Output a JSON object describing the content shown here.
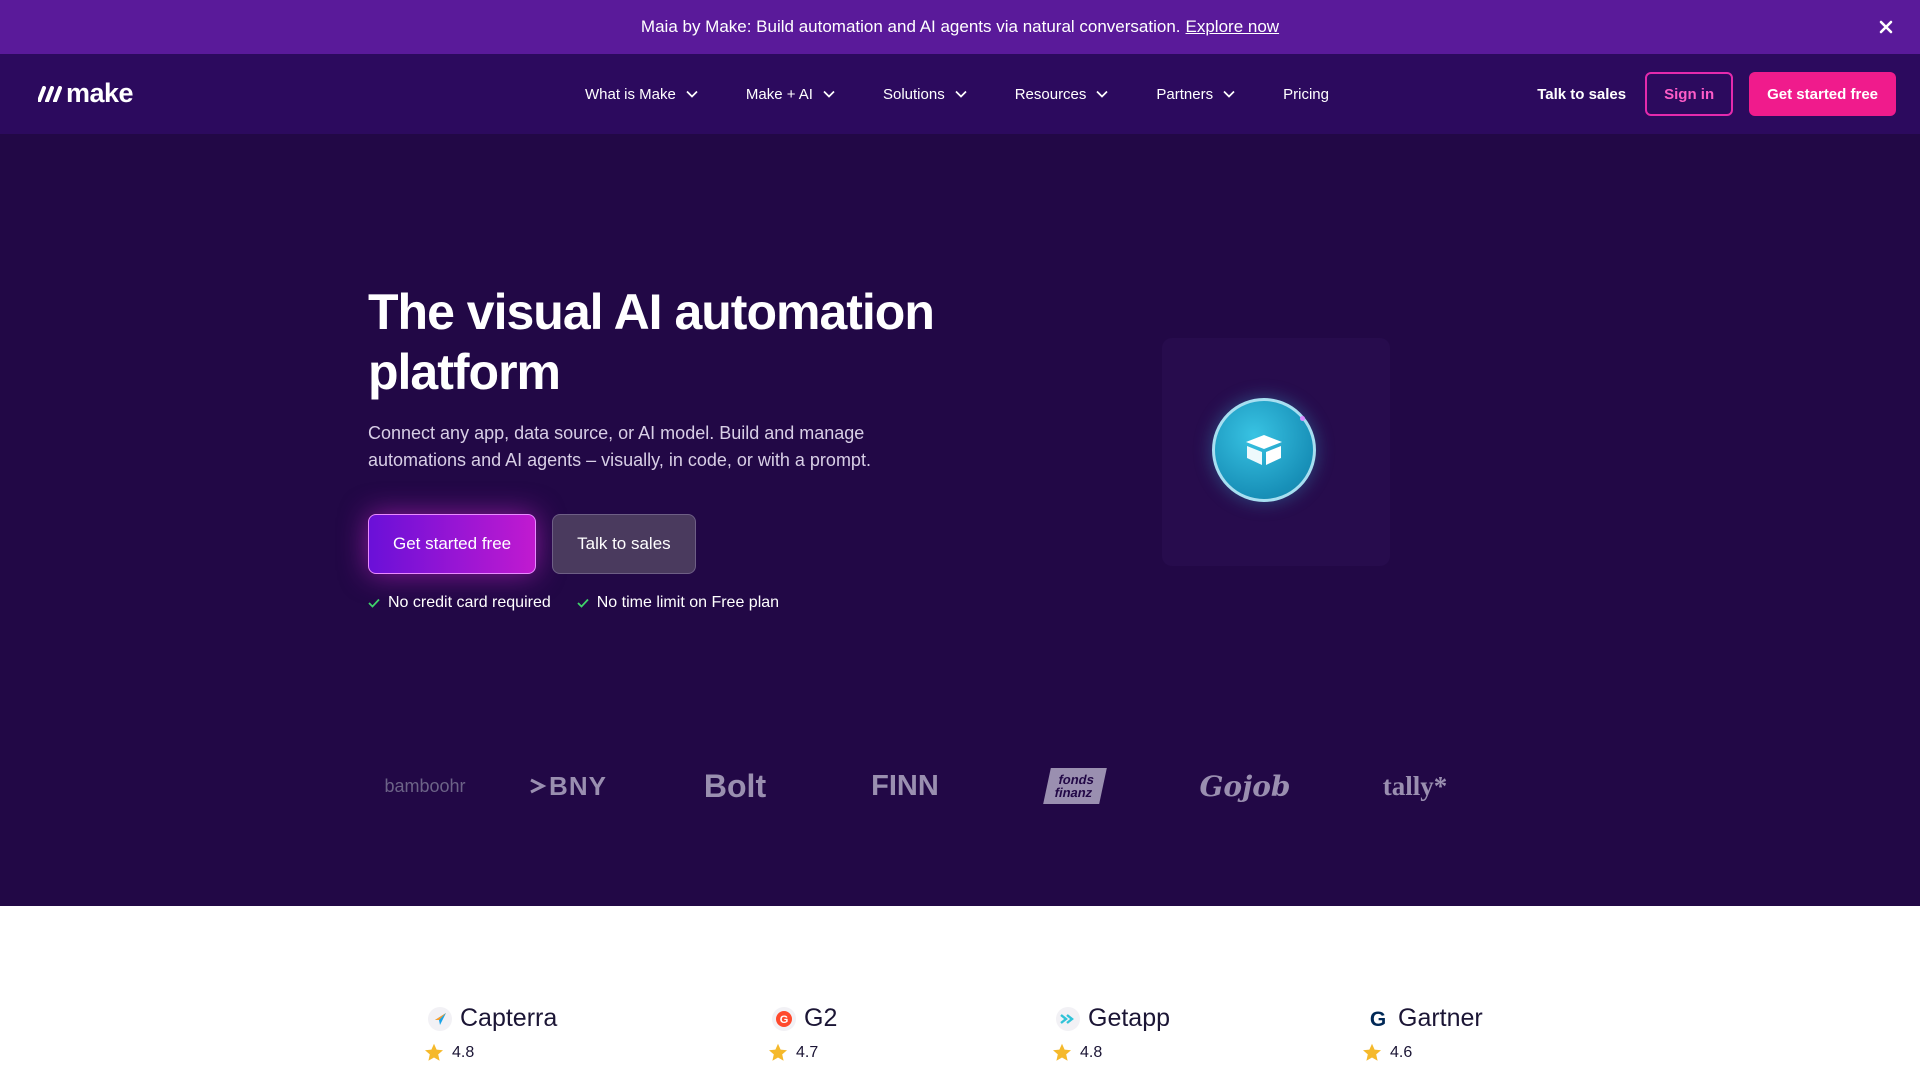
{
  "banner": {
    "text": "Maia by Make: Build automation and AI agents via natural conversation.",
    "link_label": "Explore now"
  },
  "nav": {
    "logo_text": "make",
    "items": [
      {
        "label": "What is Make",
        "has_dropdown": true
      },
      {
        "label": "Make + AI",
        "has_dropdown": true
      },
      {
        "label": "Solutions",
        "has_dropdown": true
      },
      {
        "label": "Resources",
        "has_dropdown": true
      },
      {
        "label": "Partners",
        "has_dropdown": true
      },
      {
        "label": "Pricing",
        "has_dropdown": false
      }
    ],
    "talk_to_sales": "Talk to sales",
    "sign_in": "Sign in",
    "get_started": "Get started free"
  },
  "hero": {
    "title": "The visual AI automation platform",
    "subtitle": "Connect any app, data source, or AI model. Build and manage automations and AI agents – visually, in code, or with a prompt.",
    "cta_primary": "Get started free",
    "cta_secondary": "Talk to sales",
    "checks": [
      "No credit card required",
      "No time limit on Free plan"
    ]
  },
  "logos": [
    "bamboohr",
    "BNY",
    "Bolt",
    "FINN",
    "fonds finanz",
    "Gojob",
    "tally*"
  ],
  "ratings": [
    {
      "name": "Capterra",
      "score": "4.8",
      "icon": "capterra-icon"
    },
    {
      "name": "G2",
      "score": "4.7",
      "icon": "g2-icon"
    },
    {
      "name": "Getapp",
      "score": "4.8",
      "icon": "getapp-icon"
    },
    {
      "name": "Gartner",
      "score": "4.6",
      "icon": "gartner-icon"
    }
  ],
  "colors": {
    "banner_bg": "#5a1a9a",
    "nav_bg": "#2c0a5e",
    "hero_bg": "#220846",
    "accent_pink": "#f01b8c",
    "star": "#f5b92b"
  }
}
